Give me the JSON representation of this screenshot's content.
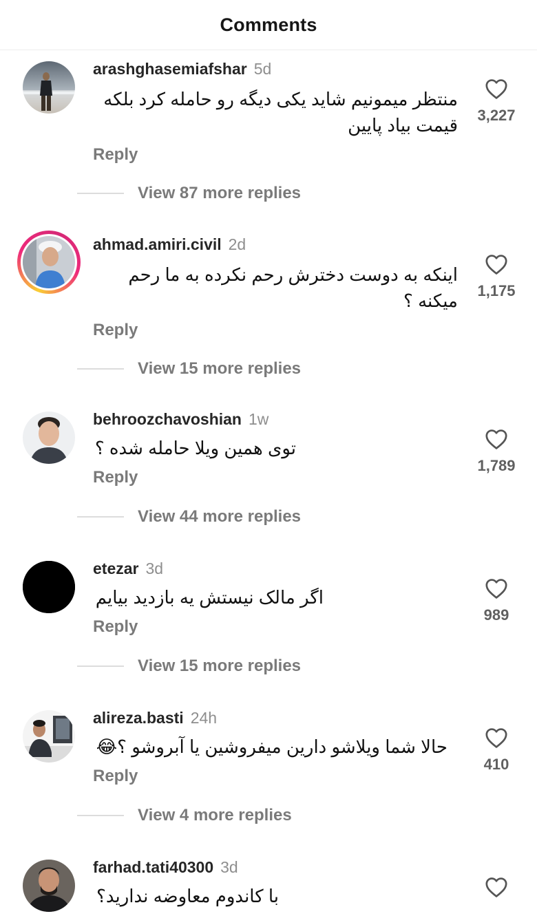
{
  "header": {
    "title": "Comments"
  },
  "comments": [
    {
      "username": "arashghasemiafshar",
      "time": "5d",
      "text": "منتظر میمونیم شاید یکی دیگه رو حامله کرد بلکه قیمت بیاد پایین",
      "reply_label": "Reply",
      "view_replies": "View 87 more replies",
      "likes": "3,227"
    },
    {
      "username": "ahmad.amiri.civil",
      "time": "2d",
      "text": "اینکه به دوست دخترش رحم نکرده به ما رحم میکنه ؟",
      "reply_label": "Reply",
      "view_replies": "View 15 more replies",
      "likes": "1,175"
    },
    {
      "username": "behroozchavoshian",
      "time": "1w",
      "text": "توی همین ویلا حامله شده ؟",
      "reply_label": "Reply",
      "view_replies": "View 44 more replies",
      "likes": "1,789"
    },
    {
      "username": "etezar",
      "time": "3d",
      "text": "اگر مالک نیستش یه بازدید بیایم",
      "reply_label": "Reply",
      "view_replies": "View 15 more replies",
      "likes": "989"
    },
    {
      "username": "alireza.basti",
      "time": "24h",
      "text": "حالا شما ویلاشو دارین میفروشین یا آبروشو ؟😂",
      "reply_label": "Reply",
      "view_replies": "View 4 more replies",
      "likes": "410"
    },
    {
      "username": "farhad.tati40300",
      "time": "3d",
      "text": "با کاندوم معاوضه ندارید؟"
    }
  ],
  "icons": {
    "like": "heart-outline-icon"
  },
  "colors": {
    "story_ring_start": "#f9ce34",
    "story_ring_end": "#ee2a7b",
    "muted_text": "#7a7a7a"
  }
}
